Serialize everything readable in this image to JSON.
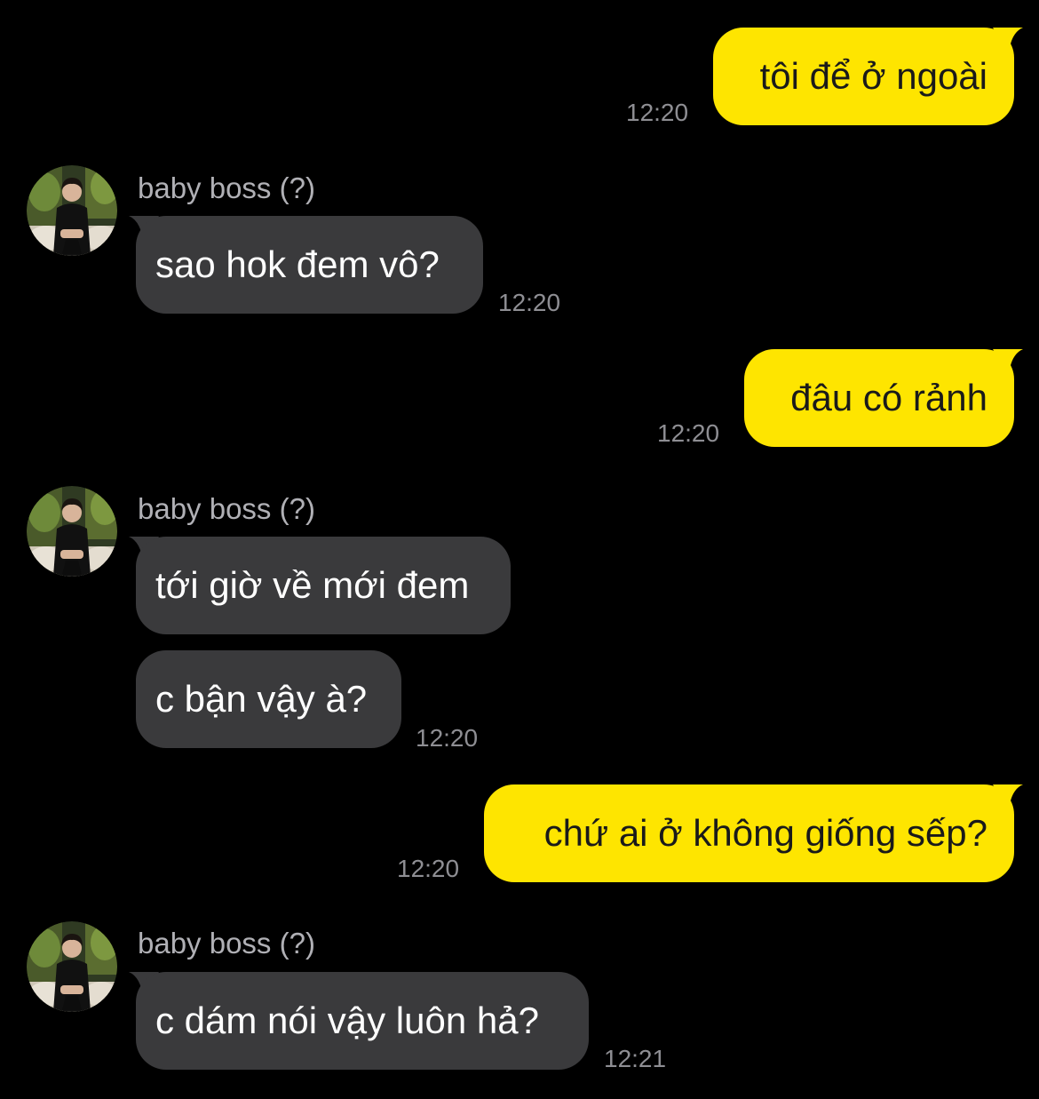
{
  "chat": {
    "messages": [
      {
        "id": "m1",
        "direction": "outgoing",
        "text": "tôi để ở ngoài",
        "time": "12:20"
      },
      {
        "id": "m2",
        "direction": "incoming",
        "sender": "baby boss (?)",
        "text": "sao hok đem vô?",
        "time": "12:20"
      },
      {
        "id": "m3",
        "direction": "outgoing",
        "text": "đâu có rảnh",
        "time": "12:20"
      },
      {
        "id": "m4",
        "direction": "incoming",
        "sender": "baby boss (?)",
        "text": "tới giờ về mới đem"
      },
      {
        "id": "m5",
        "direction": "incoming",
        "text": "c bận vậy à?",
        "time": "12:20"
      },
      {
        "id": "m6",
        "direction": "outgoing",
        "text": "chứ ai ở không giống sếp?",
        "time": "12:20"
      },
      {
        "id": "m7",
        "direction": "incoming",
        "sender": "baby boss (?)",
        "text": "c dám nói vậy luôn hả?",
        "time": "12:21"
      }
    ]
  },
  "colors": {
    "background": "#000000",
    "outgoing_bubble": "#FEE500",
    "incoming_bubble": "#3a3a3c",
    "timestamp": "#8e8e93",
    "sender_name": "#b0b0b5"
  }
}
